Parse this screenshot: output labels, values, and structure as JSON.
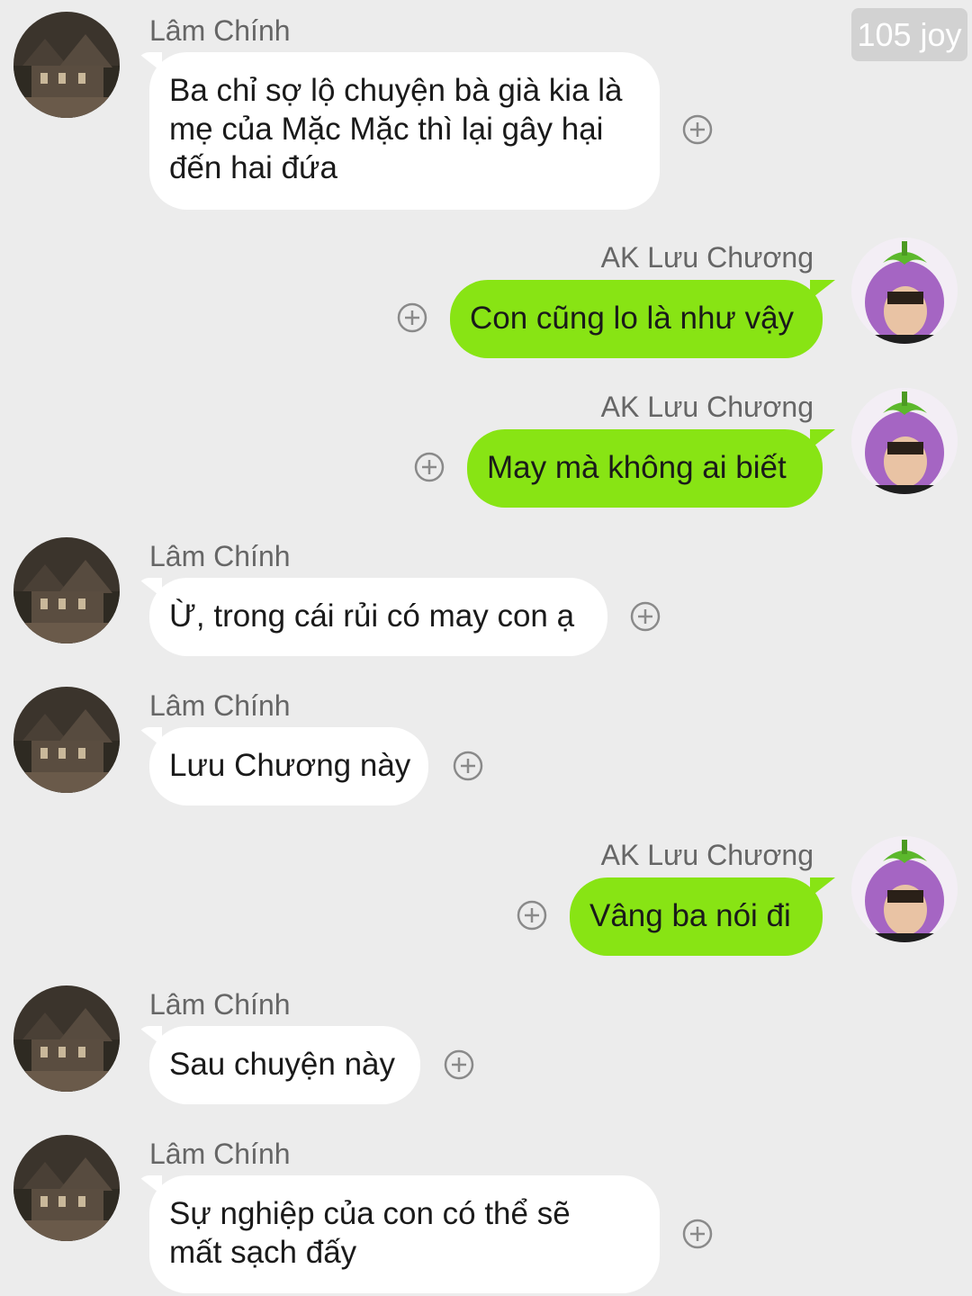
{
  "badge": "105 joy",
  "colors": {
    "background": "#ececec",
    "incoming_bubble": "#ffffff",
    "outgoing_bubble": "#88e414"
  },
  "messages": [
    {
      "sender": "Lâm Chính",
      "lines": [
        "Ba chỉ sợ lộ chuyện bà già kia là",
        "mẹ của Mặc Mặc thì lại gây hại",
        "đến hai đứa"
      ],
      "direction": "incoming"
    },
    {
      "sender": "AK Lưu Chương",
      "lines": [
        "Con cũng lo là như vậy"
      ],
      "direction": "outgoing"
    },
    {
      "sender": "AK Lưu Chương",
      "lines": [
        "May mà không ai biết"
      ],
      "direction": "outgoing"
    },
    {
      "sender": "Lâm Chính",
      "lines": [
        "Ừ, trong cái rủi có may con ạ"
      ],
      "direction": "incoming"
    },
    {
      "sender": "Lâm Chính",
      "lines": [
        "Lưu Chương này"
      ],
      "direction": "incoming"
    },
    {
      "sender": "AK Lưu Chương",
      "lines": [
        "Vâng ba nói đi"
      ],
      "direction": "outgoing"
    },
    {
      "sender": "Lâm Chính",
      "lines": [
        "Sau chuyện này"
      ],
      "direction": "incoming"
    },
    {
      "sender": "Lâm Chính",
      "lines": [
        "Sự nghiệp của con có thể sẽ",
        "mất sạch đấy"
      ],
      "direction": "incoming"
    }
  ]
}
